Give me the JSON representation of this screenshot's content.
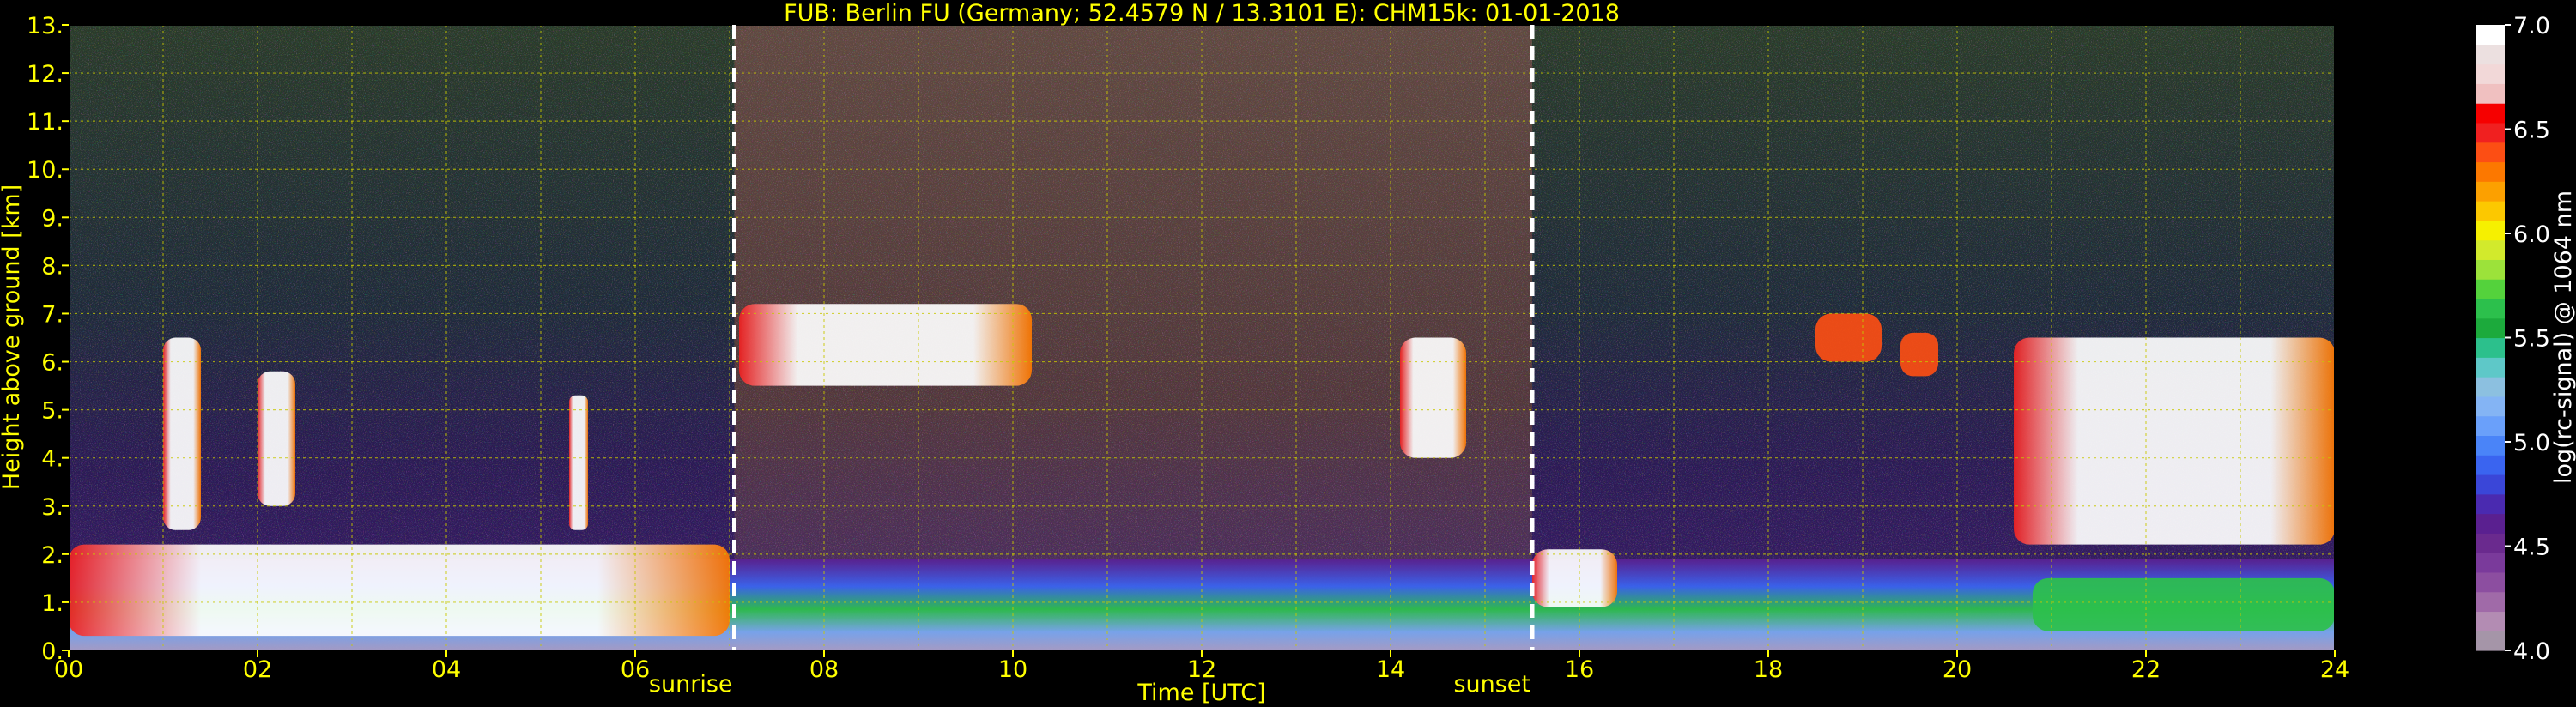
{
  "chart_data": {
    "type": "heatmap",
    "title": "FUB: Berlin FU (Germany; 52.4579 N / 13.3101 E):    CHM15k: 01-01-2018",
    "xlabel": "Time [UTC]",
    "ylabel": "Height above ground [km]",
    "xlim": [
      0,
      24
    ],
    "ylim": [
      0,
      13
    ],
    "x_ticks": [
      "00",
      "02",
      "04",
      "06",
      "08",
      "10",
      "12",
      "14",
      "16",
      "18",
      "20",
      "22",
      "24"
    ],
    "y_ticks": [
      "0.",
      "1.",
      "2.",
      "3.",
      "4.",
      "5.",
      "6.",
      "7.",
      "8.",
      "9.",
      "10.",
      "11.",
      "12.",
      "13."
    ],
    "grid": true,
    "markers": [
      {
        "label": "sunrise",
        "x": 7.05
      },
      {
        "label": "sunset",
        "x": 15.5
      }
    ],
    "colorbar": {
      "label": "log(rc-signal) @ 1064 nm",
      "range": [
        4.0,
        7.0
      ],
      "tick_labels": [
        "4.0",
        "4.5",
        "5.0",
        "5.5",
        "6.0",
        "6.5",
        "7.0"
      ],
      "colors": [
        "#a595a8",
        "#b38cb3",
        "#a06aa8",
        "#8c4ea0",
        "#7a3a9b",
        "#6a2a8e",
        "#5a2090",
        "#4a2ab0",
        "#3a46d8",
        "#3a64f0",
        "#4a84f8",
        "#6aa0fa",
        "#84b4f4",
        "#8cc0e0",
        "#5ec8c8",
        "#2cc08c",
        "#1caa3c",
        "#2cc04c",
        "#54d23c",
        "#9ce23a",
        "#d2ea2c",
        "#f6f000",
        "#fcc800",
        "#fca000",
        "#fc7800",
        "#fc4e14",
        "#f02020",
        "#f60000",
        "#f0c0c0",
        "#f2d8d8",
        "#ece0e0",
        "#ffffff"
      ]
    },
    "features": [
      {
        "x0": 0.0,
        "x1": 24.0,
        "y0": 0.0,
        "y1": 1.9,
        "level": 5.3
      },
      {
        "x0": 0.0,
        "x1": 7.0,
        "y0": 0.3,
        "y1": 2.2,
        "level": 6.8
      },
      {
        "x0": 1.0,
        "x1": 1.4,
        "y0": 2.5,
        "y1": 6.5,
        "level": 6.8
      },
      {
        "x0": 2.0,
        "x1": 2.4,
        "y0": 3.0,
        "y1": 5.8,
        "level": 6.8
      },
      {
        "x0": 5.3,
        "x1": 5.5,
        "y0": 2.5,
        "y1": 5.3,
        "level": 6.8
      },
      {
        "x0": 7.1,
        "x1": 10.2,
        "y0": 5.5,
        "y1": 7.2,
        "level": 6.8
      },
      {
        "x0": 14.1,
        "x1": 14.8,
        "y0": 4.0,
        "y1": 6.5,
        "level": 6.8
      },
      {
        "x0": 15.5,
        "x1": 16.4,
        "y0": 0.9,
        "y1": 2.1,
        "level": 6.8
      },
      {
        "x0": 18.5,
        "x1": 19.2,
        "y0": 6.0,
        "y1": 7.0,
        "level": 6.4
      },
      {
        "x0": 19.4,
        "x1": 19.8,
        "y0": 5.7,
        "y1": 6.6,
        "level": 6.4
      },
      {
        "x0": 20.6,
        "x1": 24.0,
        "y0": 2.2,
        "y1": 6.5,
        "level": 6.8
      },
      {
        "x0": 20.8,
        "x1": 24.0,
        "y0": 0.4,
        "y1": 1.5,
        "level": 5.6
      }
    ]
  }
}
